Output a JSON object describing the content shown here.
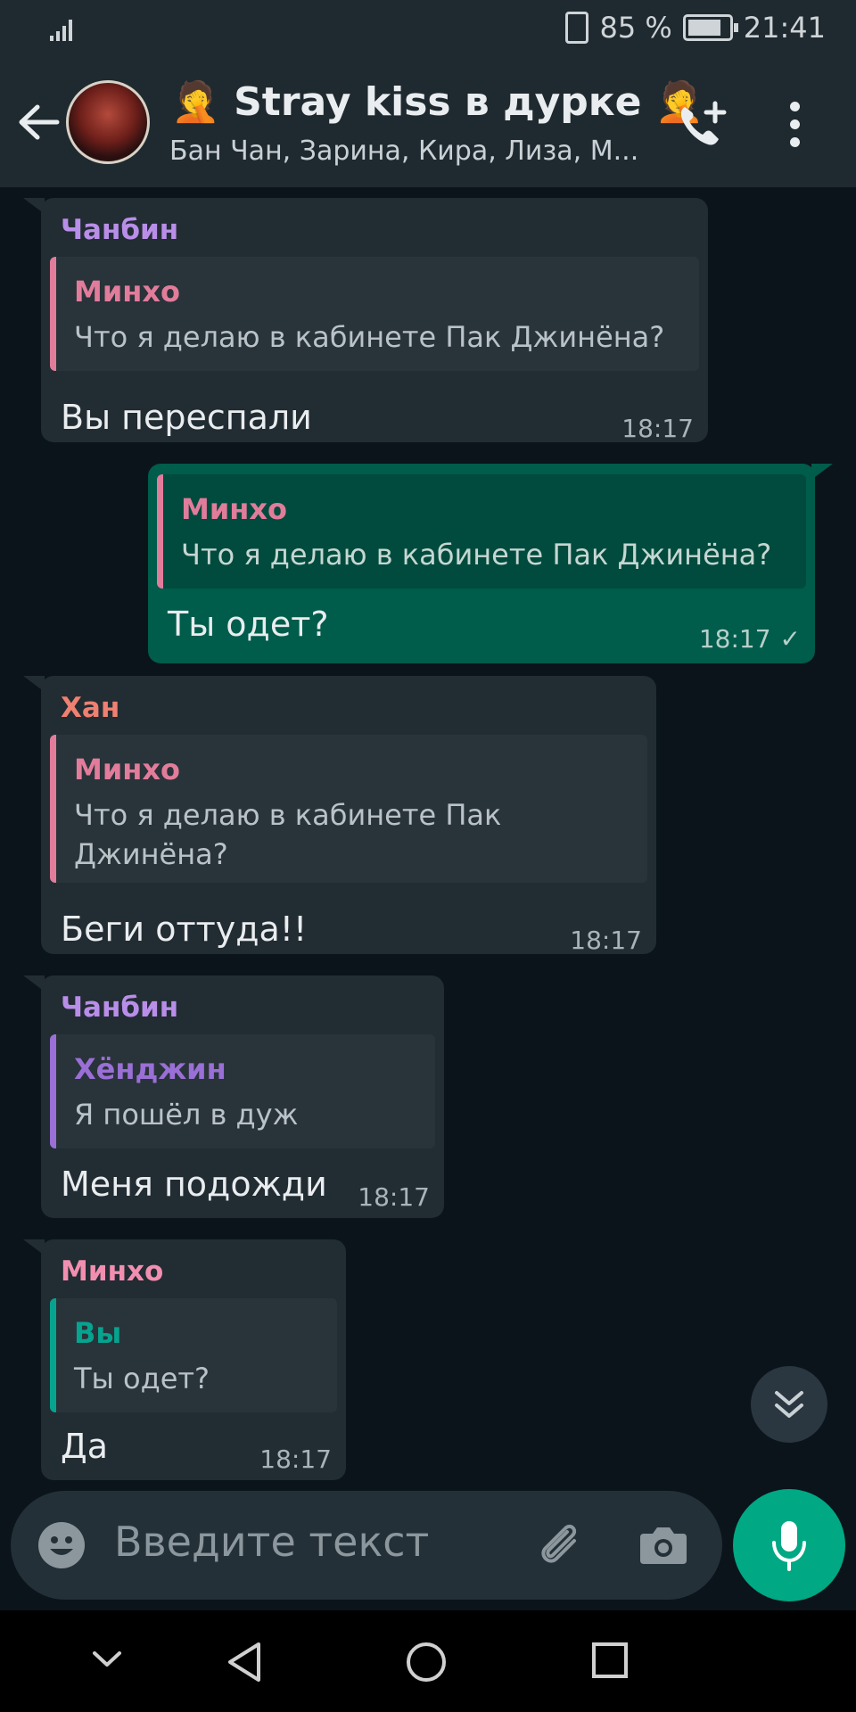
{
  "status_bar": {
    "battery": "85 %",
    "time": "21:41"
  },
  "header": {
    "title": "🤦 Stray kiss в дурке 🤦",
    "subtitle": "Бан Чан, Зарина, Кира, Лиза, М..."
  },
  "messages": [
    {
      "sender": "Чанбин",
      "quote_name": "Минхо",
      "quote_text": "Что я делаю в кабинете Пак Джинёна?",
      "text": "Вы переспали",
      "time": "18:17"
    },
    {
      "quote_name": "Минхо",
      "quote_text": "Что я делаю в кабинете Пак Джинёна?",
      "text": "Ты одет?",
      "time": "18:17",
      "status_mark": "✓"
    },
    {
      "sender": "Хан",
      "quote_name": "Минхо",
      "quote_text_line1": "Что я делаю в кабинете Пак",
      "quote_text_line2": "Джинёна?",
      "text": "Беги оттуда!!",
      "time": "18:17"
    },
    {
      "sender": "Чанбин",
      "quote_name": "Хёнджин",
      "quote_text": "Я пошёл в дуж",
      "text": "Меня подожди",
      "time": "18:17"
    },
    {
      "sender": "Минхо",
      "quote_name": "Вы",
      "quote_text": "Ты одет?",
      "text": "Да",
      "time": "18:17"
    }
  ],
  "input": {
    "placeholder": "Введите текст"
  },
  "colors": {
    "header_bg": "#1f2a30",
    "chat_bg": "#0b141b",
    "incoming_bubble": "#222c33",
    "outgoing_bubble": "#005c4b",
    "accent": "#00a884",
    "sender_changbin": "#b98ee8",
    "sender_han": "#f08070",
    "sender_minho": "#f28fb0",
    "quote_minho": "#e27c9b",
    "quote_hyunjin": "#9a6fd6",
    "quote_you": "#06a38f"
  },
  "icons": [
    "back-arrow-icon",
    "add-call-icon",
    "more-vert-icon",
    "scroll-down-icon",
    "emoji-icon",
    "attach-icon",
    "camera-icon",
    "mic-icon",
    "nav-down-icon",
    "nav-back-icon",
    "nav-home-icon",
    "nav-recent-icon"
  ]
}
